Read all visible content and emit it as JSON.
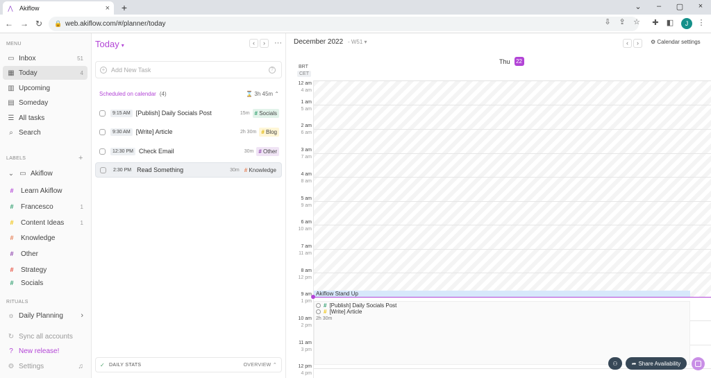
{
  "browser": {
    "tab_title": "Akiflow",
    "url": "web.akiflow.com/#/planner/today",
    "profile_initial": "J"
  },
  "sidebar": {
    "menu_label": "MENU",
    "menu": [
      {
        "label": "Inbox",
        "count": "51",
        "icon": "inbox-icon"
      },
      {
        "label": "Today",
        "count": "4",
        "icon": "calendar-today-icon"
      },
      {
        "label": "Upcoming",
        "count": "",
        "icon": "upcoming-icon"
      },
      {
        "label": "Someday",
        "count": "",
        "icon": "someday-icon"
      },
      {
        "label": "All tasks",
        "count": "",
        "icon": "all-tasks-icon"
      },
      {
        "label": "Search",
        "count": "",
        "icon": "search-icon"
      }
    ],
    "labels_label": "LABELS",
    "folder": "Akiflow",
    "labels": [
      {
        "label": "Learn Akiflow",
        "count": "",
        "color": "#b244d6"
      },
      {
        "label": "Francesco",
        "count": "1",
        "color": "#2f9e6e"
      },
      {
        "label": "Content Ideas",
        "count": "1",
        "color": "#f1c40f"
      },
      {
        "label": "Knowledge",
        "count": "",
        "color": "#e67e52"
      },
      {
        "label": "Other",
        "count": "",
        "color": "#8e44ad"
      },
      {
        "label": "Strategy",
        "count": "",
        "color": "#e74c3c"
      },
      {
        "label": "Socials",
        "count": "",
        "color": "#2f9e6e"
      }
    ],
    "rituals_label": "RITUALS",
    "daily_planning": "Daily Planning",
    "sync": "Sync all accounts",
    "new_release": "New release!",
    "settings": "Settings"
  },
  "tasks": {
    "title": "Today",
    "add_placeholder": "Add New Task",
    "scheduled_label": "Scheduled on calendar",
    "scheduled_count": "(4)",
    "scheduled_duration": "3h 45m",
    "items": [
      {
        "time": "9:15 AM",
        "title": "[Publish] Daily Socials Post",
        "duration": "15m",
        "label": "Socials",
        "label_color": "#2f9e6e",
        "label_bg": "#e2f3ea"
      },
      {
        "time": "9:30 AM",
        "title": "[Write] Article",
        "duration": "2h 30m",
        "label": "Blog",
        "label_color": "#e0b400",
        "label_bg": "#fff6d6"
      },
      {
        "time": "12:30 PM",
        "title": "Check Email",
        "duration": "30m",
        "label": "Other",
        "label_color": "#8e44ad",
        "label_bg": "#f0e4f5"
      },
      {
        "time": "2:30 PM",
        "title": "Read Something",
        "duration": "30m",
        "label": "Knowledge",
        "label_color": "#e67e52",
        "label_bg": "#fbe9e0"
      }
    ],
    "daily_stats": "DAILY STATS",
    "overview": "OVERVIEW"
  },
  "calendar": {
    "month": "December 2022",
    "week": "W51",
    "settings_label": "Calendar settings",
    "tz_primary": "BRT",
    "tz_secondary": "CET",
    "day_name": "Thu",
    "day_number": "22",
    "hours": [
      {
        "main": "12 am",
        "sub": "4 am"
      },
      {
        "main": "1 am",
        "sub": "5 am"
      },
      {
        "main": "2 am",
        "sub": "6 am"
      },
      {
        "main": "3 am",
        "sub": "7 am"
      },
      {
        "main": "4 am",
        "sub": "8 am"
      },
      {
        "main": "5 am",
        "sub": "9 am"
      },
      {
        "main": "6 am",
        "sub": "10 am"
      },
      {
        "main": "7 am",
        "sub": "11 am"
      },
      {
        "main": "8 am",
        "sub": "12 pm"
      },
      {
        "main": "9 am",
        "sub": "1 pm"
      },
      {
        "main": "10 am",
        "sub": "2 pm"
      },
      {
        "main": "11 am",
        "sub": "3 pm"
      },
      {
        "main": "12 pm",
        "sub": "4 pm"
      }
    ],
    "event_standup": "Akiflow Stand Up",
    "block_tasks": [
      {
        "title": "[Publish] Daily Socials Post",
        "color": "#2f9e6e"
      },
      {
        "title": "[Write] Article",
        "color": "#f1c40f"
      }
    ],
    "block_duration": "2h 30m",
    "share_label": "Share Availability"
  }
}
